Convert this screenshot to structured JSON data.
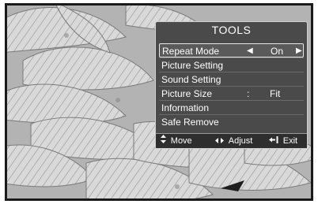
{
  "menu": {
    "title": "TOOLS",
    "items": [
      {
        "label": "Repeat Mode",
        "value": "On",
        "left_arrow": "◀",
        "right_arrow": "▶"
      },
      {
        "label": "Picture Setting"
      },
      {
        "label": "Sound Setting"
      },
      {
        "label": "Picture Size",
        "separator": ":",
        "value": "Fit"
      },
      {
        "label": "Information"
      },
      {
        "label": "Safe Remove"
      }
    ]
  },
  "footer": {
    "move_label": "Move",
    "move_icon": "▲▼",
    "adjust_label": "Adjust",
    "adjust_icon": "◀▶",
    "exit_label": "Exit",
    "exit_icon": "return-icon"
  },
  "colors": {
    "panel_bg": "#4a4a4a",
    "footer_bg": "#2e2e2e",
    "highlight_border": "#e6e6e6"
  }
}
